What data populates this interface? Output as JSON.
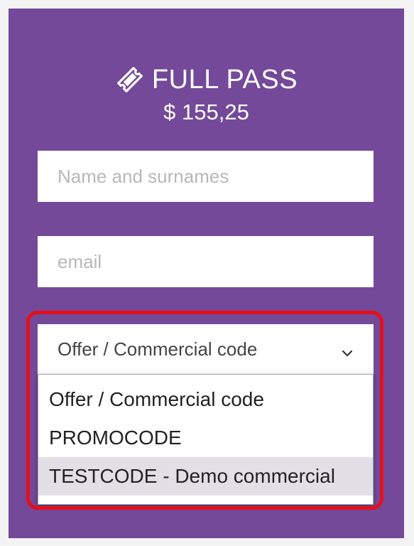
{
  "pass": {
    "title": "FULL PASS",
    "price": "$ 155,25",
    "icon": "ticket-icon"
  },
  "form": {
    "name_placeholder": "Name and surnames",
    "email_placeholder": "email",
    "code_select": {
      "selected": "Offer / Commercial code",
      "options": [
        "Offer / Commercial code",
        "PROMOCODE",
        "TESTCODE - Demo commercial"
      ],
      "hovered_index": 2
    }
  },
  "colors": {
    "card_background": "#744999",
    "highlight_border": "#e3101c",
    "text_on_card": "#ffffff"
  }
}
